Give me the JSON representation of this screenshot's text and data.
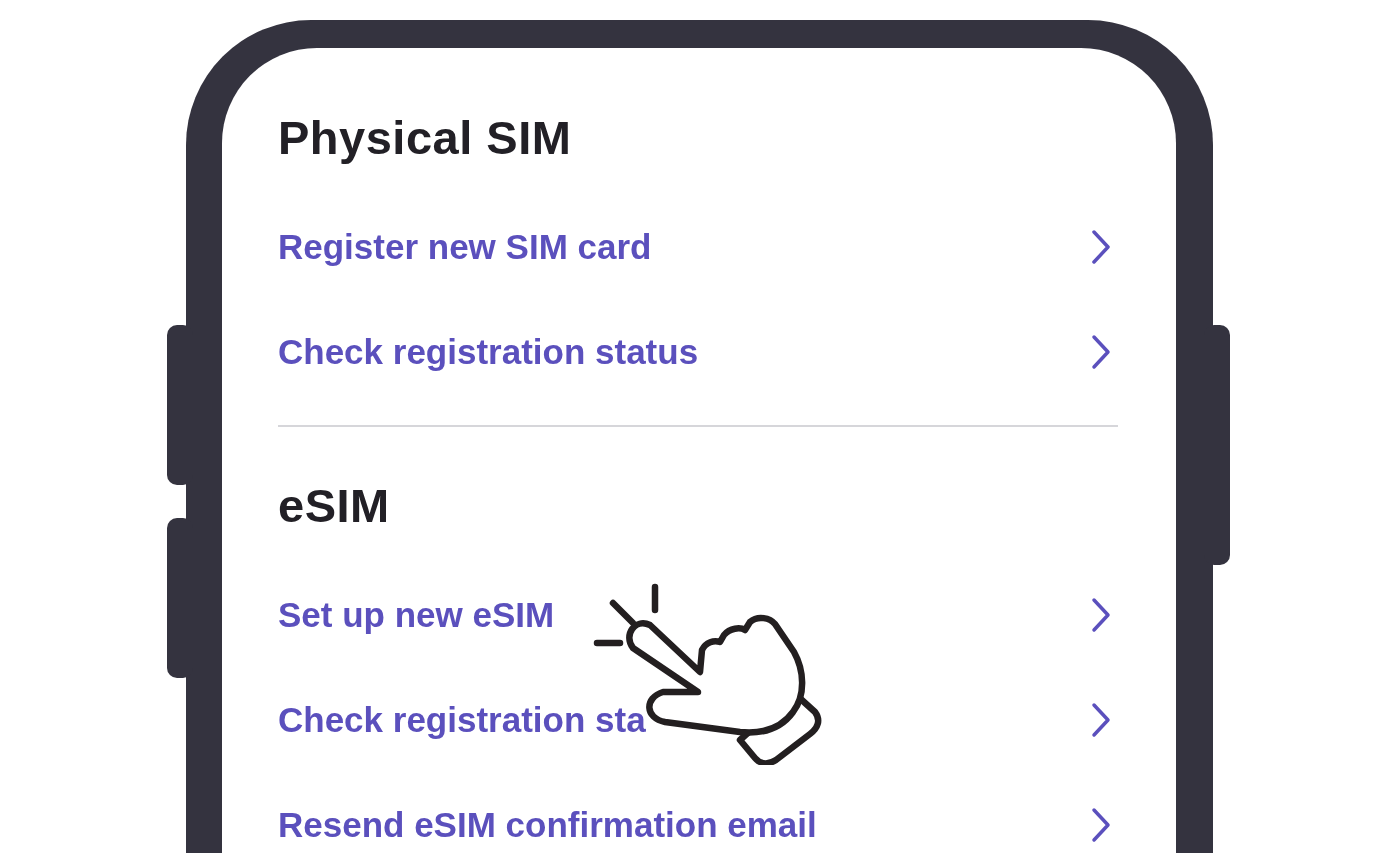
{
  "sections": [
    {
      "title": "Physical SIM",
      "items": [
        {
          "label": "Register new SIM card"
        },
        {
          "label": "Check registration status"
        }
      ]
    },
    {
      "title": "eSIM",
      "items": [
        {
          "label": "Set up new eSIM"
        },
        {
          "label": "Check registration sta"
        },
        {
          "label": "Resend eSIM confirmation email"
        }
      ]
    }
  ]
}
